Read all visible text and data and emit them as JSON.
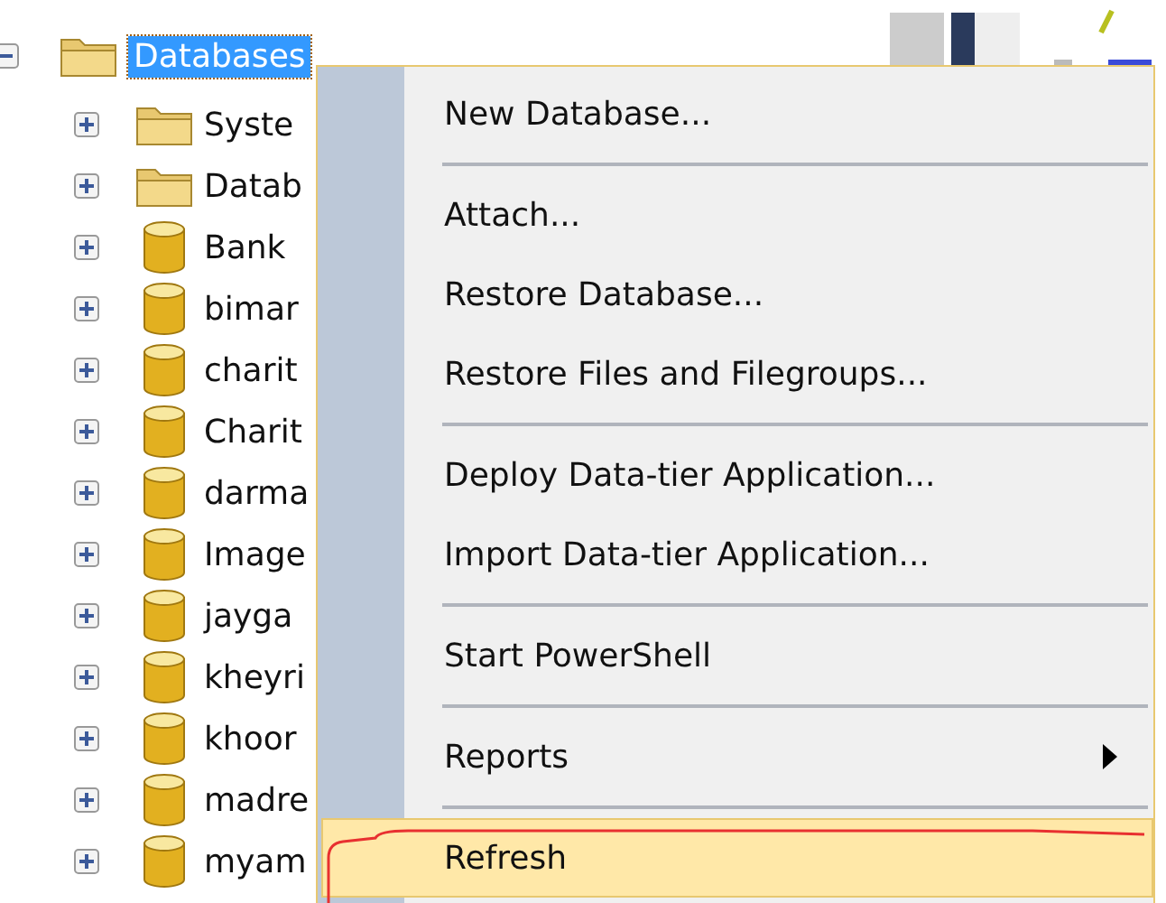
{
  "tree": {
    "label": "Databases",
    "expanded": true,
    "selected": true,
    "children": [
      {
        "label": "Syste",
        "kind": "folder"
      },
      {
        "label": "Datab",
        "kind": "folder"
      },
      {
        "label": "Bank",
        "kind": "database"
      },
      {
        "label": "bimar",
        "kind": "database"
      },
      {
        "label": "charit",
        "kind": "database"
      },
      {
        "label": "Charit",
        "kind": "database"
      },
      {
        "label": "darma",
        "kind": "database"
      },
      {
        "label": "Image",
        "kind": "database"
      },
      {
        "label": "jayga",
        "kind": "database"
      },
      {
        "label": "kheyri",
        "kind": "database"
      },
      {
        "label": "khoor",
        "kind": "database"
      },
      {
        "label": "madre",
        "kind": "database"
      },
      {
        "label": "myam",
        "kind": "database"
      }
    ]
  },
  "context_menu": {
    "items": [
      {
        "kind": "item",
        "label": "New Database...",
        "selected": false
      },
      {
        "kind": "separator"
      },
      {
        "kind": "item",
        "label": "Attach...",
        "selected": false
      },
      {
        "kind": "item",
        "label": "Restore Database...",
        "selected": false
      },
      {
        "kind": "item",
        "label": "Restore Files and Filegroups...",
        "selected": false
      },
      {
        "kind": "separator"
      },
      {
        "kind": "item",
        "label": "Deploy Data-tier Application...",
        "selected": false
      },
      {
        "kind": "item",
        "label": "Import Data-tier Application...",
        "selected": false
      },
      {
        "kind": "separator"
      },
      {
        "kind": "item",
        "label": "Start PowerShell",
        "selected": false
      },
      {
        "kind": "separator"
      },
      {
        "kind": "item",
        "label": "Reports",
        "selected": false,
        "submenu": true
      },
      {
        "kind": "separator"
      },
      {
        "kind": "item",
        "label": "Refresh",
        "selected": true
      }
    ]
  }
}
